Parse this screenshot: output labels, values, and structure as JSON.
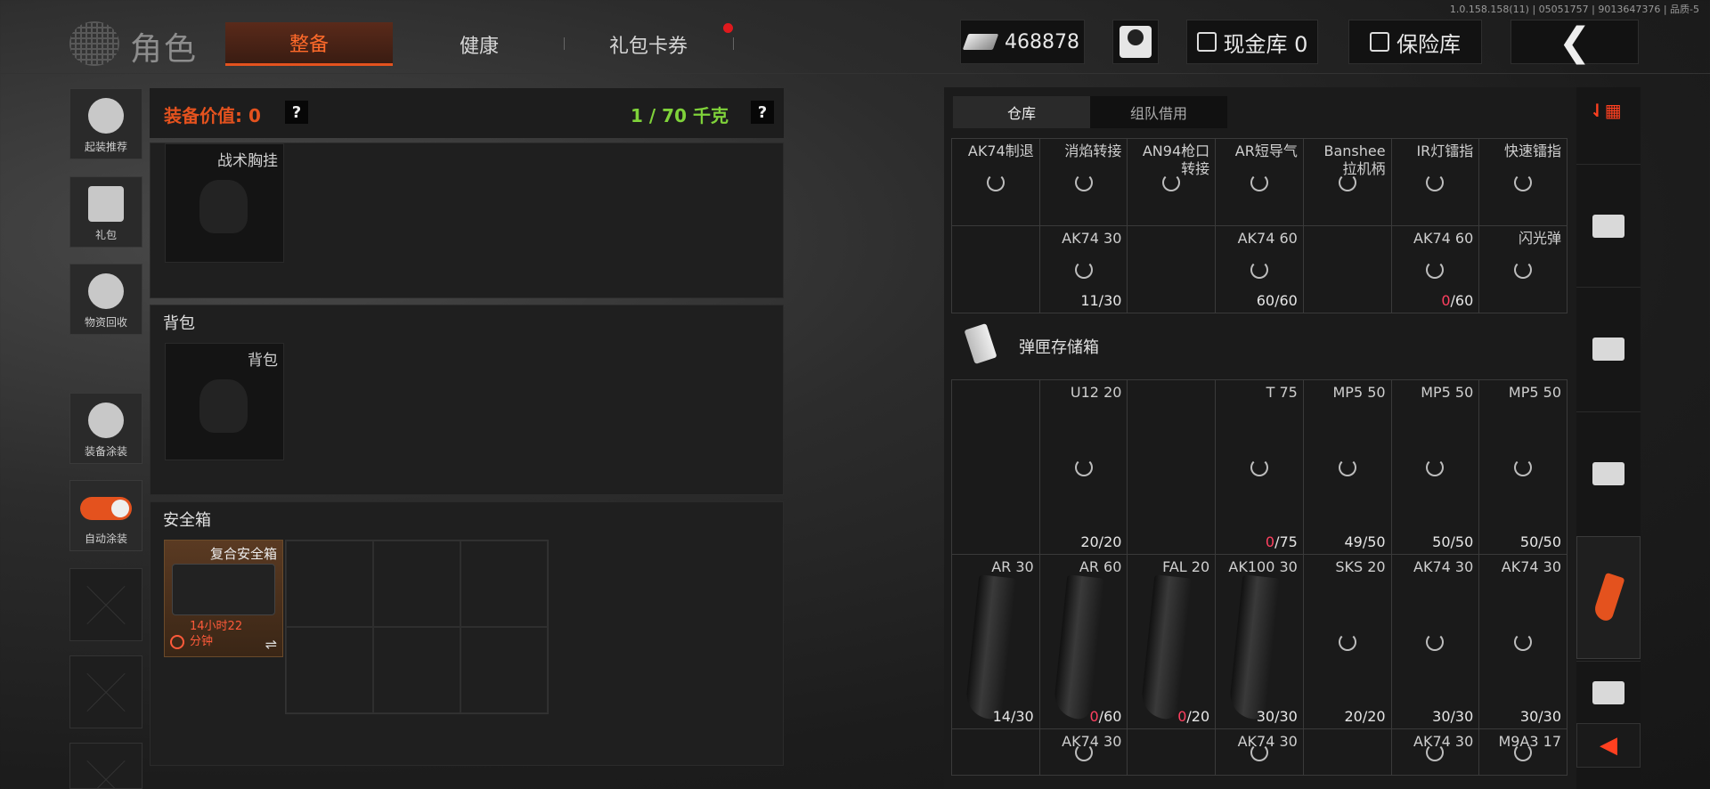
{
  "version": "1.0.158.158(11) | 05051757 | 9013647376 | 品质-5",
  "header": {
    "title": "角色",
    "tabs": [
      {
        "label": "整备",
        "active": true
      },
      {
        "label": "健康",
        "active": false
      },
      {
        "label": "礼包卡券",
        "active": false
      }
    ],
    "money": "468878",
    "cash_vault": "现金库 0",
    "insurance": "保险库",
    "back": "❮"
  },
  "sidebar": {
    "items": [
      "起装推荐",
      "礼包",
      "物资回收",
      "装备涂装",
      "自动涂装"
    ]
  },
  "equipment": {
    "value_label": "装备价值: 0",
    "weight": "1 / 70 千克",
    "help": "?",
    "chest_rig_slot": "战术胸挂",
    "backpack_title": "背包",
    "backpack_slot": "背包",
    "safe_title": "安全箱",
    "safe_case": {
      "name": "复合安全箱",
      "timer_line1": "14小时22",
      "timer_line2": "分钟",
      "swap": "⇌"
    }
  },
  "warehouse": {
    "tabs": [
      {
        "label": "仓库",
        "active": true
      },
      {
        "label": "组队借用",
        "active": false
      }
    ],
    "attachments_row1": [
      {
        "name": "AK74制退",
        "count": ""
      },
      {
        "name": "消焰转接",
        "count": ""
      },
      {
        "name": "AN94枪口\n转接",
        "count": ""
      },
      {
        "name": "AR短导气",
        "count": ""
      },
      {
        "name": "Banshee\n拉机柄",
        "count": ""
      },
      {
        "name": "IR灯镭指",
        "count": ""
      },
      {
        "name": "快速镭指",
        "count": ""
      }
    ],
    "attachments_row2": [
      {
        "name": "",
        "count": ""
      },
      {
        "name": "AK74 30",
        "count": "11/30"
      },
      {
        "name": "",
        "count": ""
      },
      {
        "name": "AK74 60",
        "count": "60/60"
      },
      {
        "name": "",
        "count": ""
      },
      {
        "name": "AK74 60",
        "count_zero": "0",
        "count_rest": "/60"
      },
      {
        "name": "闪光弹",
        "count": ""
      }
    ],
    "mag_storage_label": "弹匣存储箱",
    "mags_row1": [
      {
        "name": "",
        "count": ""
      },
      {
        "name": "U12 20",
        "count": "20/20"
      },
      {
        "name": "",
        "count": ""
      },
      {
        "name": "T 75",
        "count_zero": "0",
        "count_rest": "/75"
      },
      {
        "name": "MP5 50",
        "count": "49/50"
      },
      {
        "name": "MP5 50",
        "count": "50/50"
      },
      {
        "name": "MP5 50",
        "count": "50/50"
      }
    ],
    "mags_row2": [
      {
        "name": "AR 30",
        "count": "14/30"
      },
      {
        "name": "AR 60",
        "count_zero": "0",
        "count_rest": "/60"
      },
      {
        "name": "FAL 20",
        "count_zero": "0",
        "count_rest": "/20"
      },
      {
        "name": "AK100 30",
        "count": "30/30"
      },
      {
        "name": "SKS 20",
        "count": "20/20"
      },
      {
        "name": "AK74 30",
        "count": "30/30"
      },
      {
        "name": "AK74 30",
        "count": "30/30"
      }
    ],
    "mags_row3": [
      {
        "name": "",
        "count": ""
      },
      {
        "name": "AK74 30",
        "count": ""
      },
      {
        "name": "",
        "count": ""
      },
      {
        "name": "AK74 30",
        "count": ""
      },
      {
        "name": "",
        "count": ""
      },
      {
        "name": "AK74 30",
        "count": ""
      },
      {
        "name": "M9A3 17",
        "count": ""
      }
    ]
  }
}
